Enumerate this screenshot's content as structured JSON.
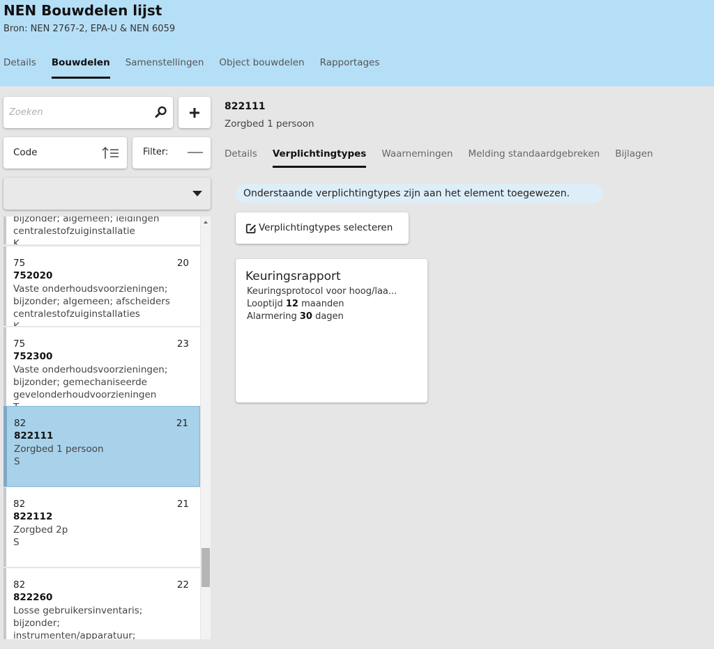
{
  "app": {
    "title": "NEN Bouwdelen lijst",
    "source": "Bron: NEN 2767-2, EPA-U & NEN 6059"
  },
  "main_tabs": [
    {
      "label": "Details",
      "active": false
    },
    {
      "label": "Bouwdelen",
      "active": true
    },
    {
      "label": "Samenstellingen",
      "active": false
    },
    {
      "label": "Object bouwdelen",
      "active": false
    },
    {
      "label": "Rapportages",
      "active": false
    }
  ],
  "search": {
    "placeholder": "Zoeken",
    "value": ""
  },
  "sort": {
    "label": "Code"
  },
  "filter": {
    "label": "Filter:"
  },
  "dropdown": {
    "selected": ""
  },
  "list": {
    "partial_top": {
      "line1": "bijzonder; algemeen; leidingen",
      "line2": "centralestofzuiginstallatie",
      "letter": "K"
    },
    "items": [
      {
        "group": "75",
        "count": "20",
        "code": "752020",
        "description": "Vaste onderhoudsvoorzieningen; bijzonder; algemeen; afscheiders centralestofzuiginstallaties",
        "letter": "K"
      },
      {
        "group": "75",
        "count": "23",
        "code": "752300",
        "description": "Vaste onderhoudsvoorzieningen; bijzonder; gemechaniseerde gevelonderhoudvoorzieningen",
        "letter": "T"
      },
      {
        "group": "82",
        "count": "21",
        "code": "822111",
        "description": "Zorgbed 1 persoon",
        "letter": "S"
      },
      {
        "group": "82",
        "count": "21",
        "code": "822112",
        "description": "Zorgbed 2p",
        "letter": "S"
      },
      {
        "group": "82",
        "count": "22",
        "code": "822260",
        "description": "Losse gebruikersinventaris; bijzonder; instrumenten/apparatuur;",
        "letter": ""
      }
    ]
  },
  "detail": {
    "code": "822111",
    "name": "Zorgbed 1 persoon",
    "tabs": [
      {
        "label": "Details",
        "active": false
      },
      {
        "label": "Verplichtingtypes",
        "active": true
      },
      {
        "label": "Waarnemingen",
        "active": false
      },
      {
        "label": "Melding standaardgebreken",
        "active": false
      },
      {
        "label": "Bijlagen",
        "active": false
      }
    ],
    "info": "Onderstaande verplichtingtypes zijn aan het element toegewezen.",
    "select_button": "Verplichtingtypes selecteren",
    "obligation": {
      "title": "Keuringsrapport",
      "description": "Keuringsprotocol voor hoog/laa...",
      "duration_label": "Looptijd",
      "duration_value": "12",
      "duration_unit": "maanden",
      "alert_label": "Alarmering",
      "alert_value": "30",
      "alert_unit": "dagen"
    }
  },
  "colors": {
    "header_bg": "#b5dff7",
    "selected_bg": "#a8d2ea",
    "banner_bg": "#ddeef8",
    "page_bg": "#e6e6e6"
  }
}
